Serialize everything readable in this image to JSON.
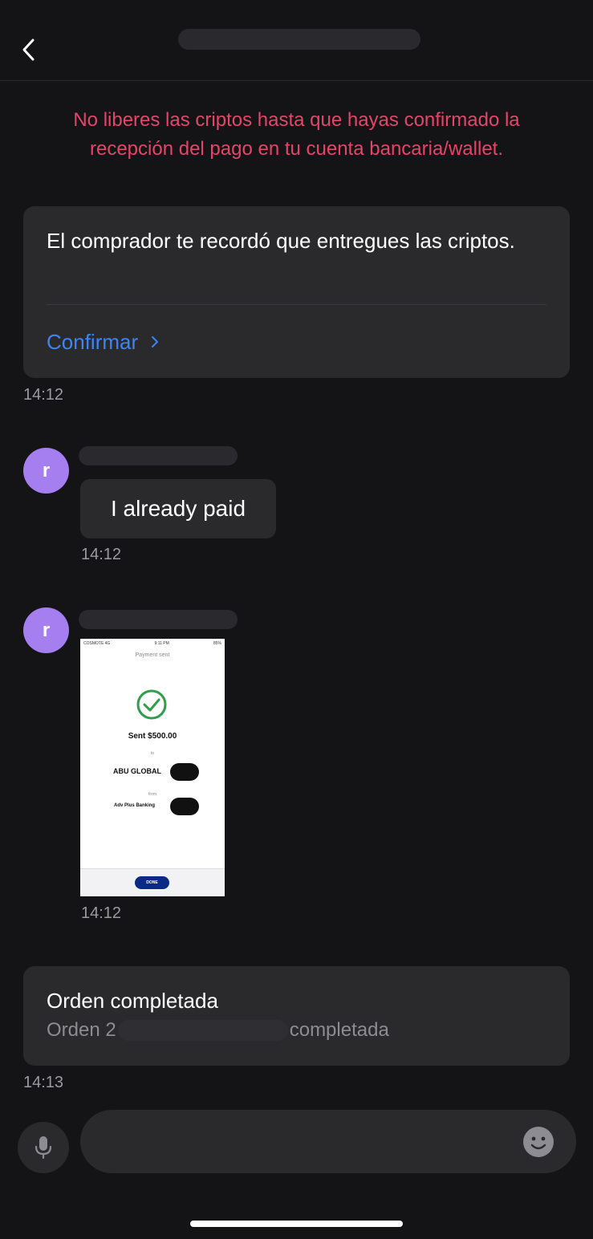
{
  "header": {
    "back_icon": "chevron-left-icon",
    "title_redacted": true
  },
  "warning": {
    "text": "No liberes las criptos hasta que hayas confirmado la recepción del pago en tu cuenta bancaria/wallet.",
    "color": "#e5456a"
  },
  "messages": {
    "reminder": {
      "text": "El comprador te recordó que entregues las criptos.",
      "action_label": "Confirmar",
      "action_color": "#3d84f5",
      "time": "14:12"
    },
    "text_message": {
      "avatar_letter": "r",
      "text": "I already paid",
      "time": "14:12"
    },
    "image_message": {
      "avatar_letter": "r",
      "time": "14:12",
      "screenshot": {
        "carrier": "COSMOTE 4G",
        "clock": "9:11 PM",
        "battery": "85%",
        "heading": "Payment sent",
        "amount_line": "Sent $500.00",
        "to_label": "to",
        "recipient": "ABU GLOBAL",
        "from_label": "from",
        "source": "Adv Plus Banking",
        "button": "DONE"
      }
    },
    "order": {
      "title": "Orden completada",
      "prefix": "Orden 2",
      "suffix": "completada",
      "time": "14:13"
    }
  },
  "composer": {
    "mic_icon": "microphone-icon",
    "placeholder": "",
    "emoji_icon": "smiley-icon"
  },
  "colors": {
    "background": "#141416",
    "card": "#2a2a2d",
    "avatar": "#a57ff0",
    "timestamp": "#9a9aa0"
  }
}
